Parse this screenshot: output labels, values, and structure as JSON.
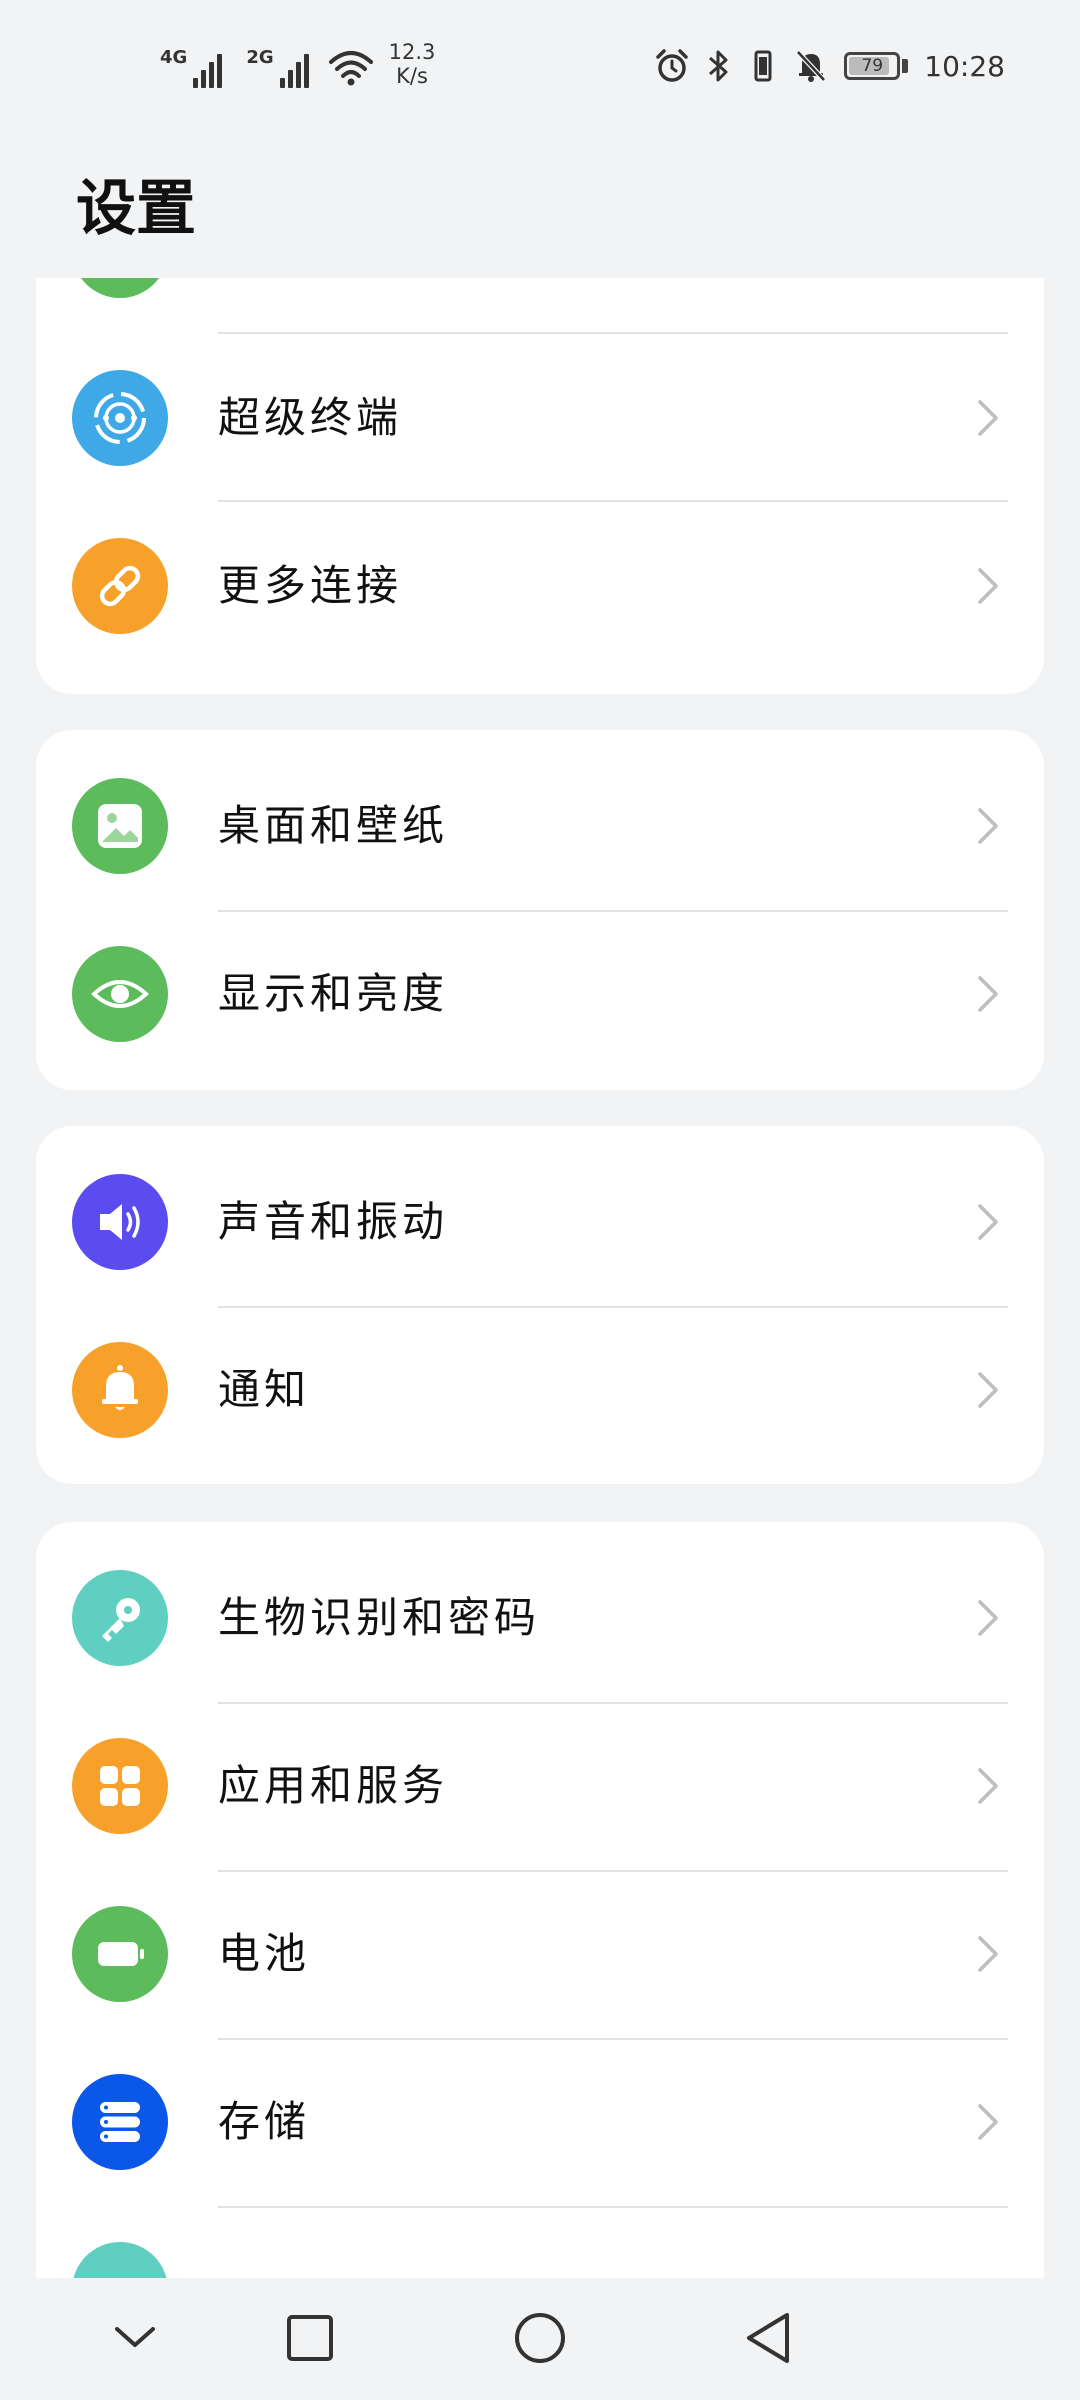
{
  "status_bar": {
    "signal1_label": "4G",
    "signal2_label": "2G",
    "speed_value": "12.3",
    "speed_unit": "K/s",
    "battery_level": "79",
    "time": "10:28"
  },
  "header": {
    "title": "设置"
  },
  "settings": {
    "group1": [
      {
        "label": "超级终端",
        "icon": "super-device-icon",
        "color": "#3fa9e8"
      },
      {
        "label": "更多连接",
        "icon": "link-icon",
        "color": "#f7a12a"
      }
    ],
    "group2": [
      {
        "label": "桌面和壁纸",
        "icon": "wallpaper-icon",
        "color": "#5cbb5b"
      },
      {
        "label": "显示和亮度",
        "icon": "eye-icon",
        "color": "#5cbb5b"
      }
    ],
    "group3": [
      {
        "label": "声音和振动",
        "icon": "speaker-icon",
        "color": "#5b4cf0"
      },
      {
        "label": "通知",
        "icon": "bell-icon",
        "color": "#f7a12a"
      }
    ],
    "group4": [
      {
        "label": "生物识别和密码",
        "icon": "key-icon",
        "color": "#5ecfc1"
      },
      {
        "label": "应用和服务",
        "icon": "apps-icon",
        "color": "#f7a12a"
      },
      {
        "label": "电池",
        "icon": "battery-icon",
        "color": "#5cbb5b"
      },
      {
        "label": "存储",
        "icon": "storage-icon",
        "color": "#0b57e8"
      }
    ]
  },
  "colors": {
    "background": "#f1f3f5",
    "card": "#ffffff",
    "chevron": "#bdbdbd"
  }
}
